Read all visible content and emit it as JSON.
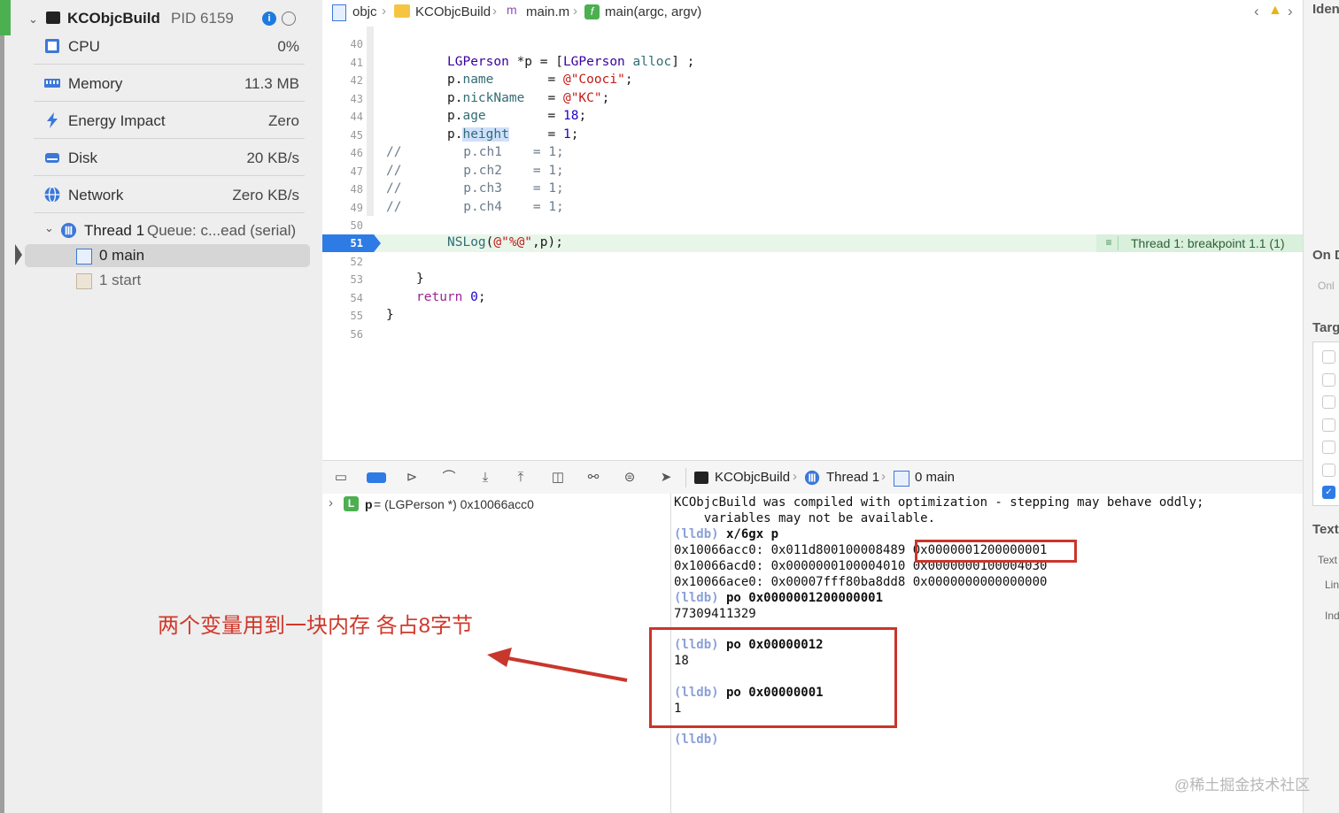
{
  "sidebar": {
    "process_name": "KCObjcBuild",
    "process_pid": "PID 6159",
    "gauges": [
      {
        "label": "CPU",
        "value": "0%",
        "icon": "cpu-icon"
      },
      {
        "label": "Memory",
        "value": "11.3 MB",
        "icon": "memory-icon"
      },
      {
        "label": "Energy Impact",
        "value": "Zero",
        "icon": "energy-icon"
      },
      {
        "label": "Disk",
        "value": "20 KB/s",
        "icon": "disk-icon"
      },
      {
        "label": "Network",
        "value": "Zero KB/s",
        "icon": "network-icon"
      }
    ],
    "thread_label": "Thread 1",
    "thread_queue": "Queue: c...ead (serial)",
    "frames": [
      {
        "label": "0 main",
        "selected": true
      },
      {
        "label": "1 start",
        "selected": false
      }
    ]
  },
  "jumpbar": {
    "crumbs": [
      "objc",
      "KCObjcBuild",
      "main.m",
      "main(argc, argv)"
    ]
  },
  "editor": {
    "line_numbers": [
      "40",
      "41",
      "42",
      "43",
      "44",
      "45",
      "46",
      "47",
      "48",
      "49",
      "50",
      "51",
      "52",
      "53",
      "54",
      "55",
      "56"
    ],
    "current_line": "51",
    "breakpoint_text": "Thread 1: breakpoint 1.1 (1)",
    "code": {
      "l41_a": "LGPerson",
      "l41_b": " *p = [",
      "l41_c": "LGPerson",
      "l41_d": " ",
      "l41_e": "alloc",
      "l41_f": "] ;",
      "l42_a": "p.",
      "l42_b": "name",
      "l42_c": "       = ",
      "l42_d": "@\"Cooci\"",
      "l42_e": ";",
      "l43_a": "p.",
      "l43_b": "nickName",
      "l43_c": "   = ",
      "l43_d": "@\"KC\"",
      "l43_e": ";",
      "l44_a": "p.",
      "l44_b": "age",
      "l44_c": "        = ",
      "l44_d": "18",
      "l44_e": ";",
      "l45_a": "p.",
      "l45_b": "height",
      "l45_c": "     = ",
      "l45_d": "1",
      "l45_e": ";",
      "l46": "//        p.ch1    = 1;",
      "l47": "//        p.ch2    = 1;",
      "l48": "//        p.ch3    = 1;",
      "l49": "//        p.ch4    = 1;",
      "l51_a": "NSLog",
      "l51_b": "(",
      "l51_c": "@\"%@\"",
      "l51_d": ",p);",
      "l53": "}",
      "l54_a": "return",
      "l54_b": " ",
      "l54_c": "0",
      "l54_d": ";",
      "l55": "}"
    }
  },
  "debugbar": {
    "crumbs": [
      "KCObjcBuild",
      "Thread 1",
      "0 main"
    ]
  },
  "variables": {
    "var_name": "p",
    "var_value": " = (LGPerson *) 0x10066acc0",
    "var_badge": "L"
  },
  "console": {
    "warning_1": "KCObjcBuild was compiled with optimization - stepping may behave oddly;",
    "warning_2": "    variables may not be available.",
    "prompt": "(lldb)",
    "cmd_1": " x/6gx p",
    "mem_1": "0x10066acc0: 0x011d800100008489 0x0000001200000001",
    "mem_2": "0x10066acd0: 0x0000000100004010 0x0000000100004030",
    "mem_3": "0x10066ace0: 0x00007fff80ba8dd8 0x0000000000000000",
    "cmd_2": " po 0x0000001200000001",
    "out_2": "77309411329",
    "cmd_3": " po 0x00000012",
    "out_3": "18",
    "cmd_4": " po 0x00000001",
    "out_4": "1"
  },
  "inspector": {
    "labels": [
      "Iden",
      "On D",
      "Onl",
      "Targ",
      "Text",
      "Text",
      "Lin",
      "Ind"
    ]
  },
  "annotation": {
    "text": "两个变量用到一块内存 各占8字节",
    "color": "#d0382b"
  },
  "watermark": "@稀土掘金技术社区",
  "colors": {
    "accent": "#1f7ae0",
    "breakpoint": "#2f7be5",
    "annotation": "#c9362b"
  }
}
